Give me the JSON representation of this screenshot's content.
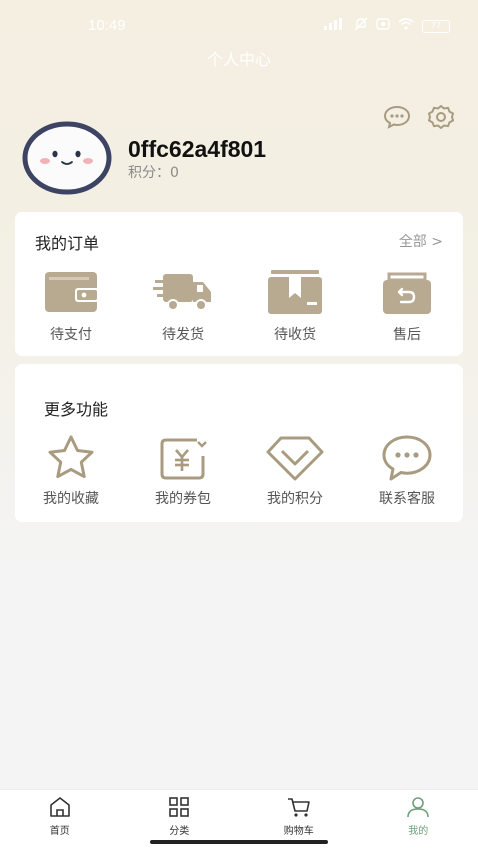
{
  "status_bar": {
    "time": "10:49",
    "network": "5G",
    "battery": "77"
  },
  "header": {
    "title": "个人中心"
  },
  "user": {
    "name": "0ffc62a4f801",
    "points_label": "积分：",
    "points_value": "0"
  },
  "orders": {
    "title": "我的订单",
    "view_all": "全部 >",
    "items": [
      {
        "label": "待支付",
        "icon": "wallet-icon"
      },
      {
        "label": "待发货",
        "icon": "delivery-truck-icon"
      },
      {
        "label": "待收货",
        "icon": "package-icon"
      },
      {
        "label": "售后",
        "icon": "return-bag-icon"
      }
    ]
  },
  "more": {
    "title": "更多功能",
    "items": [
      {
        "label": "我的收藏",
        "icon": "star-icon"
      },
      {
        "label": "我的券包",
        "icon": "coupon-icon"
      },
      {
        "label": "我的积分",
        "icon": "diamond-icon"
      },
      {
        "label": "联系客服",
        "icon": "chat-bubble-icon"
      }
    ]
  },
  "tabbar": {
    "active": "我的",
    "items": [
      {
        "label": "首页",
        "icon": "home-icon"
      },
      {
        "label": "分类",
        "icon": "category-grid-icon"
      },
      {
        "label": "购物车",
        "icon": "cart-icon"
      },
      {
        "label": "我的",
        "icon": "user-icon"
      }
    ]
  },
  "colors": {
    "accent": "#6f9f7b",
    "icon_tan": "#b7aa90",
    "bg_top": "#f4efe1"
  }
}
